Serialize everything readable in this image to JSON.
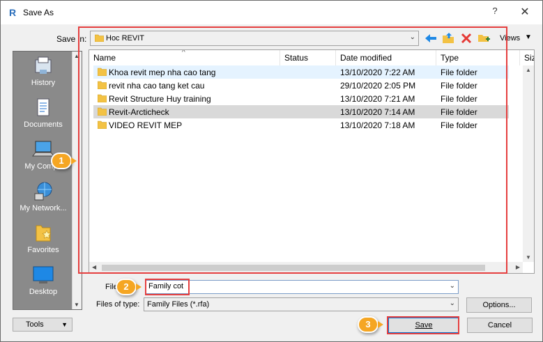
{
  "window": {
    "title": "Save As",
    "help_label": "?",
    "close_label": "✕"
  },
  "toolbar": {
    "save_in_label": "Save in:",
    "save_in_value": "Hoc REVIT",
    "views_label": "Views"
  },
  "places": [
    {
      "label": "History",
      "icon": "history-icon"
    },
    {
      "label": "Documents",
      "icon": "documents-icon"
    },
    {
      "label": "My Compu",
      "icon": "my-computer-icon"
    },
    {
      "label": "My Network...",
      "icon": "network-icon"
    },
    {
      "label": "Favorites",
      "icon": "favorites-icon"
    },
    {
      "label": "Desktop",
      "icon": "desktop-icon"
    }
  ],
  "filelist": {
    "columns": [
      "Name",
      "Status",
      "Date modified",
      "Type",
      "Siz"
    ],
    "rows": [
      {
        "name": "Khoa revit mep nha cao tang",
        "status": "",
        "date": "13/10/2020 7:22 AM",
        "type": "File folder"
      },
      {
        "name": "revit nha cao tang ket cau",
        "status": "",
        "date": "29/10/2020 2:05 PM",
        "type": "File folder"
      },
      {
        "name": "Revit Structure Huy training",
        "status": "",
        "date": "13/10/2020 7:21 AM",
        "type": "File folder"
      },
      {
        "name": "Revit-Arcticheck",
        "status": "",
        "date": "13/10/2020 7:14 AM",
        "type": "File folder"
      },
      {
        "name": "VIDEO REVIT MEP",
        "status": "",
        "date": "13/10/2020 7:18 AM",
        "type": "File folder"
      }
    ]
  },
  "form": {
    "file_name_label": "File",
    "file_name_value": "Family cot",
    "file_type_label": "Files of type:",
    "file_type_value": "Family Files  (*.rfa)"
  },
  "buttons": {
    "options": "Options...",
    "tools": "Tools",
    "save": "Save",
    "cancel": "Cancel"
  },
  "callouts": [
    "1",
    "2",
    "3"
  ],
  "colors": {
    "annotation_red": "#e53e3e",
    "callout_orange": "#f5a623",
    "places_bg": "#8a8a8a",
    "accent_blue": "#0078d7"
  }
}
